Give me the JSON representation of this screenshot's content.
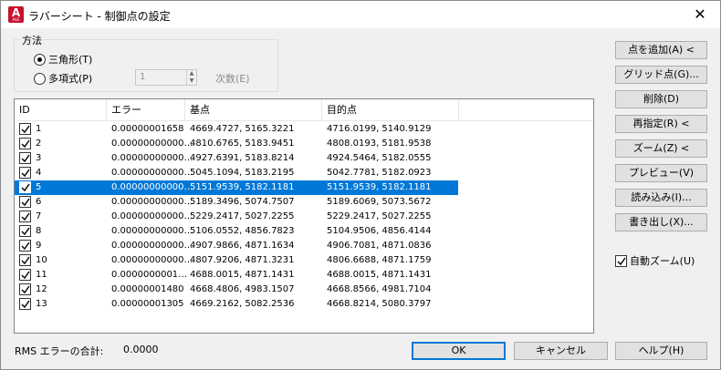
{
  "window": {
    "title": "ラバーシート - 制御点の設定",
    "app_icon_letter": "A",
    "app_icon_sub": "AGE",
    "close_glyph": "✕"
  },
  "method": {
    "group_title": "方法",
    "triangular_label": "三角形(T)",
    "triangular_selected": true,
    "polynomial_label": "多項式(P)",
    "polynomial_selected": false,
    "order_value": "1",
    "order_label": "次数(E)"
  },
  "table": {
    "columns": [
      "ID",
      "エラー",
      "基点",
      "目的点"
    ],
    "rows": [
      {
        "id": "1",
        "error": "0.00000001658",
        "base": "4669.4727, 5165.3221",
        "target": "4716.0199, 5140.9129",
        "checked": true,
        "selected": false
      },
      {
        "id": "2",
        "error": "0.00000000000…",
        "base": "4810.6765, 5183.9451",
        "target": "4808.0193, 5181.9538",
        "checked": true,
        "selected": false
      },
      {
        "id": "3",
        "error": "0.00000000000…",
        "base": "4927.6391, 5183.8214",
        "target": "4924.5464, 5182.0555",
        "checked": true,
        "selected": false
      },
      {
        "id": "4",
        "error": "0.00000000000…",
        "base": "5045.1094, 5183.2195",
        "target": "5042.7781, 5182.0923",
        "checked": true,
        "selected": false
      },
      {
        "id": "5",
        "error": "0.00000000000…",
        "base": "5151.9539, 5182.1181",
        "target": "5151.9539, 5182.1181",
        "checked": true,
        "selected": true
      },
      {
        "id": "6",
        "error": "0.00000000000…",
        "base": "5189.3496, 5074.7507",
        "target": "5189.6069, 5073.5672",
        "checked": true,
        "selected": false
      },
      {
        "id": "7",
        "error": "0.00000000000…",
        "base": "5229.2417, 5027.2255",
        "target": "5229.2417, 5027.2255",
        "checked": true,
        "selected": false
      },
      {
        "id": "8",
        "error": "0.00000000000…",
        "base": "5106.0552, 4856.7823",
        "target": "5104.9506, 4856.4144",
        "checked": true,
        "selected": false
      },
      {
        "id": "9",
        "error": "0.00000000000…",
        "base": "4907.9866, 4871.1634",
        "target": "4906.7081, 4871.0836",
        "checked": true,
        "selected": false
      },
      {
        "id": "10",
        "error": "0.00000000000…",
        "base": "4807.9206, 4871.3231",
        "target": "4806.6688, 4871.1759",
        "checked": true,
        "selected": false
      },
      {
        "id": "11",
        "error": "0.0000000001…",
        "base": "4688.0015, 4871.1431",
        "target": "4688.0015, 4871.1431",
        "checked": true,
        "selected": false
      },
      {
        "id": "12",
        "error": "0.00000001480",
        "base": "4668.4806, 4983.1507",
        "target": "4668.8566, 4981.7104",
        "checked": true,
        "selected": false
      },
      {
        "id": "13",
        "error": "0.00000001305",
        "base": "4669.2162, 5082.2536",
        "target": "4668.8214, 5080.3797",
        "checked": true,
        "selected": false
      }
    ]
  },
  "side_buttons": {
    "add_point": "点を追加(A) <",
    "grid_points": "グリッド点(G)...",
    "delete": "削除(D)",
    "respecify": "再指定(R) <",
    "zoom": "ズーム(Z) <",
    "preview": "プレビュー(V)",
    "import": "読み込み(I)...",
    "export": "書き出し(X)...",
    "auto_zoom_label": "自動ズーム(U)",
    "auto_zoom_checked": true
  },
  "footer": {
    "rms_label": "RMS エラーの合計:",
    "rms_value": "0.0000",
    "ok": "OK",
    "cancel": "キャンセル",
    "help": "ヘルプ(H)"
  },
  "colors": {
    "selection": "#0078d7",
    "app_icon": "#c8102e"
  }
}
